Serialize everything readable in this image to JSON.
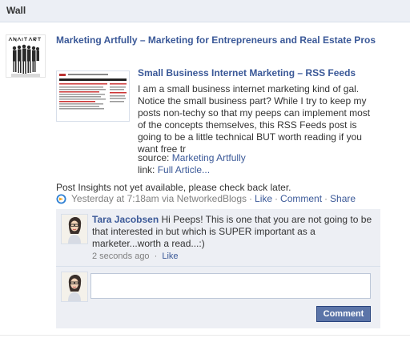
{
  "wall": {
    "title": "Wall"
  },
  "post": {
    "title": "Marketing Artfully – Marketing for Entrepreneurs and Real Estate Pros",
    "thumb_brand": "MARKETING ARTFULLY",
    "article": {
      "title": "Small Business Internet Marketing – RSS Feeds",
      "description": "I am a small business internet marketing kind of gal. Notice the small business part? While I try to keep my posts non-techy so that my peeps can implement most of the concepts themselves, this RSS Feeds post is going to be a little technical BUT worth reading if you want free tr",
      "source_label": "source:",
      "source_link": "Marketing Artfully",
      "link_label": "link:",
      "link_text": "Full Article..."
    },
    "insights": "Post Insights not yet available, please check back later.",
    "timestamp": "Yesterday at 7:18am via NetworkedBlogs",
    "actions": {
      "like": "Like",
      "comment": "Comment",
      "share": "Share",
      "sep": "·"
    }
  },
  "comments": [
    {
      "author": "Tara Jacobsen",
      "text": "Hi Peeps! This is one that you are not going to be that interested in but which is SUPER important as a marketer...worth a read...:)",
      "time": "2 seconds ago",
      "sep": "·",
      "like": "Like"
    }
  ],
  "composer": {
    "input_value": "",
    "button_label": "Comment"
  },
  "icons": {
    "networkedblogs": "networkedblogs-icon"
  },
  "colors": {
    "link": "#3b5998",
    "header_bg": "#eceff5",
    "comment_bg": "#edeff4",
    "button_bg": "#5b74a8"
  }
}
